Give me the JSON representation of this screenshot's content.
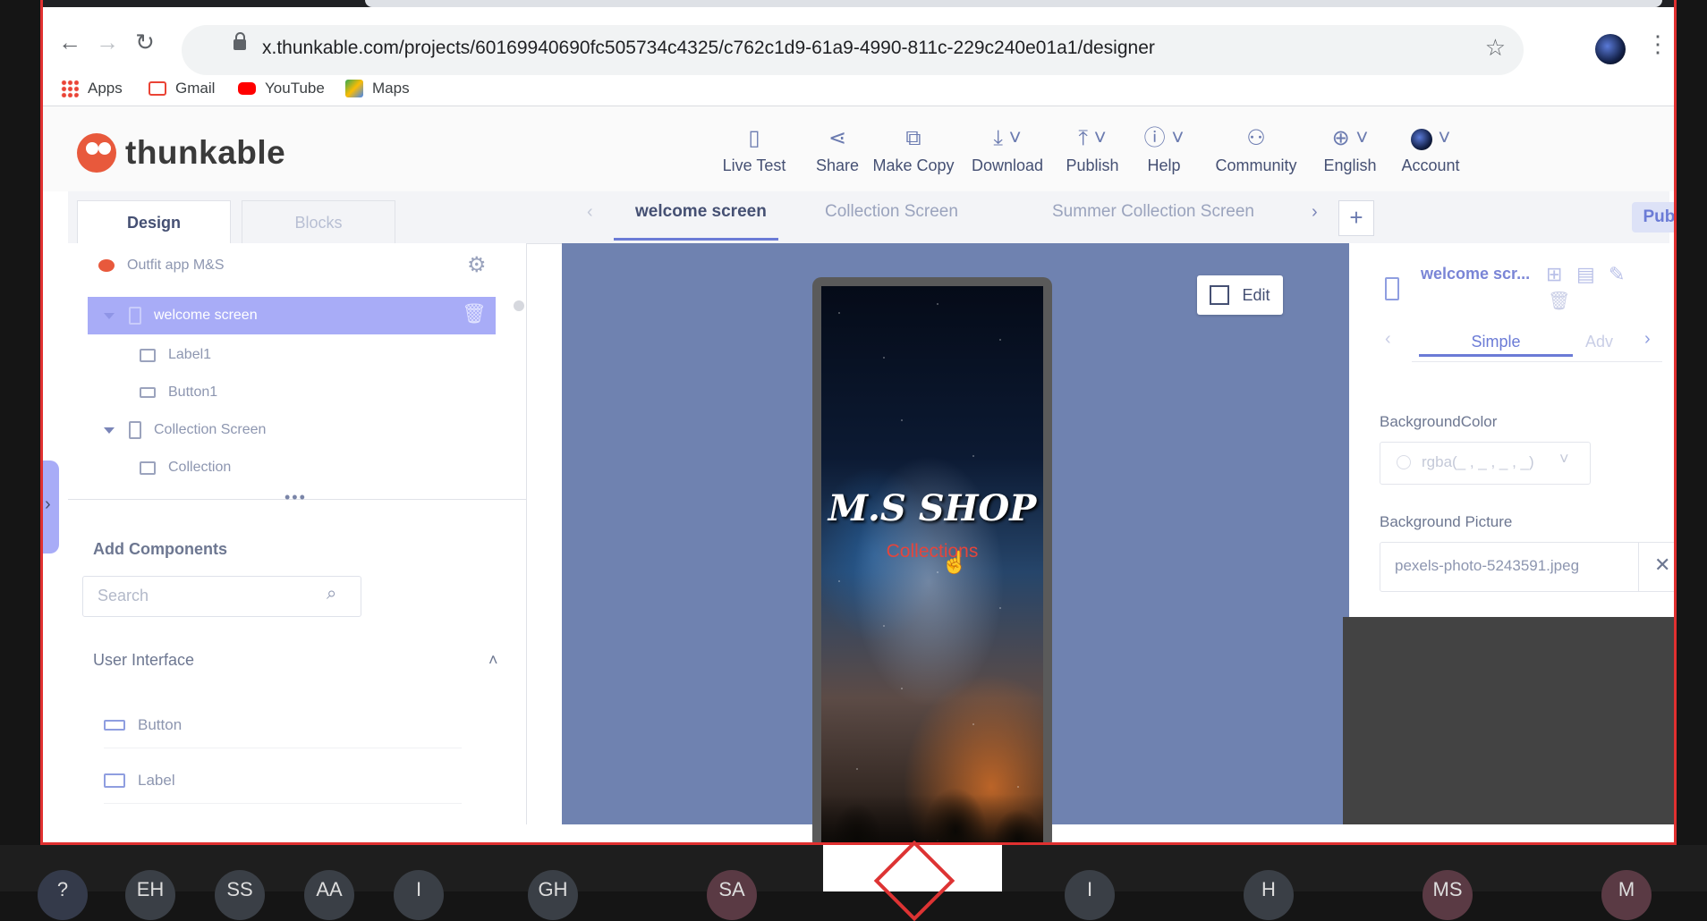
{
  "browser": {
    "url": "x.thunkable.com/projects/60169940690fc505734c4325/c762c1d9-61a9-4990-811c-229c240e01a1/designer",
    "bookmarks": [
      {
        "label": "Apps",
        "icon": "apps-grid-icon"
      },
      {
        "label": "Gmail",
        "icon": "gmail-icon"
      },
      {
        "label": "YouTube",
        "icon": "youtube-icon"
      },
      {
        "label": "Maps",
        "icon": "maps-icon"
      }
    ]
  },
  "app": {
    "logo_text": "thunkable",
    "header_buttons": [
      {
        "label": "Live Test",
        "icon": "live-test-icon"
      },
      {
        "label": "Share",
        "icon": "share-icon"
      },
      {
        "label": "Make Copy",
        "icon": "copy-icon"
      },
      {
        "label": "Download",
        "icon": "download-icon"
      },
      {
        "label": "Publish",
        "icon": "publish-icon"
      },
      {
        "label": "Help",
        "icon": "help-icon"
      },
      {
        "label": "Community",
        "icon": "community-icon"
      },
      {
        "label": "English",
        "icon": "globe-icon"
      },
      {
        "label": "Account",
        "icon": "avatar"
      }
    ]
  },
  "tabs": {
    "design": "Design",
    "blocks": "Blocks",
    "screens": [
      "welcome screen",
      "Collection Screen",
      "Summer Collection Screen"
    ],
    "active_screen": "welcome screen",
    "public": "Public"
  },
  "tree": {
    "project": "Outfit app M&S",
    "items": [
      {
        "label": "welcome screen",
        "selected": true
      },
      {
        "label": "Label1"
      },
      {
        "label": "Button1"
      },
      {
        "label": "Collection Screen"
      },
      {
        "label": "Collection"
      }
    ]
  },
  "components": {
    "title": "Add Components",
    "search_placeholder": "Search",
    "section": "User Interface",
    "items": [
      "Button",
      "Label"
    ]
  },
  "canvas": {
    "edit": "Edit",
    "phone_title": "M.S SHOP",
    "phone_button": "Collections"
  },
  "properties": {
    "screen_name": "welcome scr...",
    "tab_simple": "Simple",
    "tab_advanced": "Adv",
    "bg_color_label": "BackgroundColor",
    "bg_color_value": "rgba(_ , _ , _ , _)",
    "bg_picture_label": "Background Picture",
    "bg_picture_value": "pexels-photo-5243591.jpeg"
  },
  "participants": [
    "?",
    "EH",
    "SS",
    "AA",
    "I",
    "GH",
    "SA",
    "I",
    "H",
    "MS",
    "M"
  ],
  "colors": {
    "accent": "#6b7bd6",
    "selection": "#a8acf7",
    "canvas_bg": "#6f82b0",
    "frame_border": "#e03030"
  }
}
